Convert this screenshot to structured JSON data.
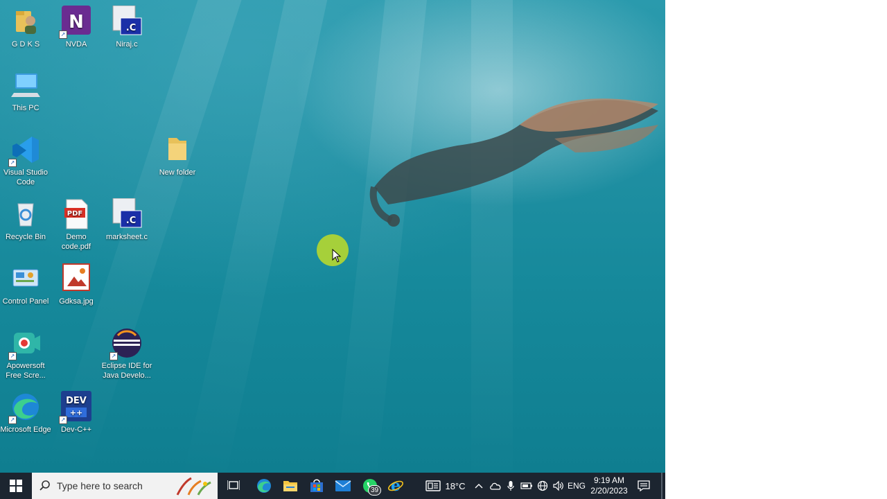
{
  "desktop": {
    "icons": [
      {
        "id": "gdks",
        "label": "G D K S",
        "icon": "user-folder-icon"
      },
      {
        "id": "nvda",
        "label": "NVDA",
        "icon": "nvda-icon"
      },
      {
        "id": "niraj",
        "label": "Niraj.c",
        "icon": "dev-c-file-icon"
      },
      {
        "id": "thispc",
        "label": "This PC",
        "icon": "computer-icon"
      },
      {
        "id": "vscode",
        "label": "Visual Studio Code",
        "icon": "vscode-icon"
      },
      {
        "id": "newfolder",
        "label": "New folder",
        "icon": "folder-icon"
      },
      {
        "id": "recycle",
        "label": "Recycle Bin",
        "icon": "recycle-bin-icon"
      },
      {
        "id": "demopdf",
        "label": "Demo code.pdf",
        "icon": "pdf-icon"
      },
      {
        "id": "marksheet",
        "label": "marksheet.c",
        "icon": "dev-c-file-icon"
      },
      {
        "id": "control",
        "label": "Control Panel",
        "icon": "control-panel-icon"
      },
      {
        "id": "gdksa",
        "label": "Gdksa.jpg",
        "icon": "image-file-icon"
      },
      {
        "id": "apowersoft",
        "label": "Apowersoft Free Scre...",
        "icon": "apowersoft-icon"
      },
      {
        "id": "eclipse",
        "label": "Eclipse IDE for Java Develo...",
        "icon": "eclipse-icon"
      },
      {
        "id": "edge",
        "label": "Microsoft Edge",
        "icon": "edge-icon"
      },
      {
        "id": "devcpp",
        "label": "Dev-C++",
        "icon": "devcpp-icon"
      }
    ]
  },
  "taskbar": {
    "search_placeholder": "Type here to search",
    "whatsapp_badge": "39",
    "weather": "18°C",
    "language": "ENG",
    "time": "9:19 AM",
    "date": "2/20/2023"
  },
  "colors": {
    "taskbar_bg": "#1c2530",
    "water": "#1f8fa2",
    "cursor_highlight": "#bedc28"
  }
}
